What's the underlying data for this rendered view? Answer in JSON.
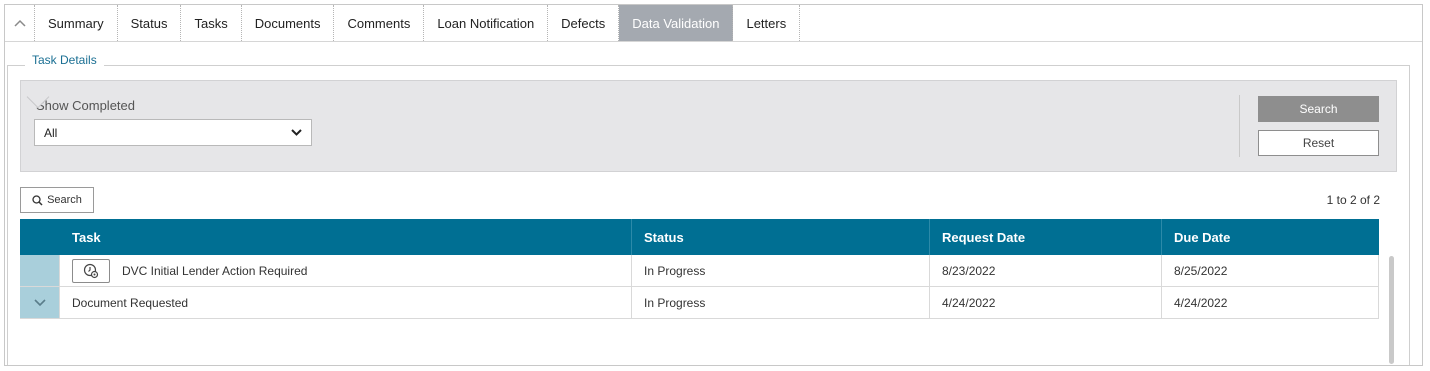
{
  "tabs": {
    "collapse_icon": "chevron-up-icon",
    "items": [
      {
        "label": "Summary"
      },
      {
        "label": "Status"
      },
      {
        "label": "Tasks"
      },
      {
        "label": "Documents"
      },
      {
        "label": "Comments"
      },
      {
        "label": "Loan Notification"
      },
      {
        "label": "Defects"
      },
      {
        "label": "Data Validation"
      },
      {
        "label": "Letters"
      }
    ],
    "active": "Data Validation"
  },
  "section": {
    "legend": "Task Details"
  },
  "filter": {
    "show_completed_label": "Show Completed",
    "show_completed_value": "All",
    "search_label": "Search",
    "reset_label": "Reset"
  },
  "toolbar": {
    "search_toggle_label": "Search",
    "result_count": "1 to 2 of 2"
  },
  "table": {
    "columns": [
      "Task",
      "Status",
      "Request Date",
      "Due Date"
    ],
    "rows": [
      {
        "task": "DVC Initial Lender Action Required",
        "status": "In Progress",
        "request_date": "8/23/2022",
        "due_date": "8/25/2022",
        "has_action_icon": true
      },
      {
        "task": "Document Requested",
        "status": "In Progress",
        "request_date": "4/24/2022",
        "due_date": "4/24/2022",
        "has_action_icon": false
      }
    ]
  },
  "colors": {
    "header_bg": "#006f93",
    "active_tab_bg": "#a4a9b0",
    "expander_bg": "#a9cfdb",
    "legend_text": "#1a6f93"
  }
}
